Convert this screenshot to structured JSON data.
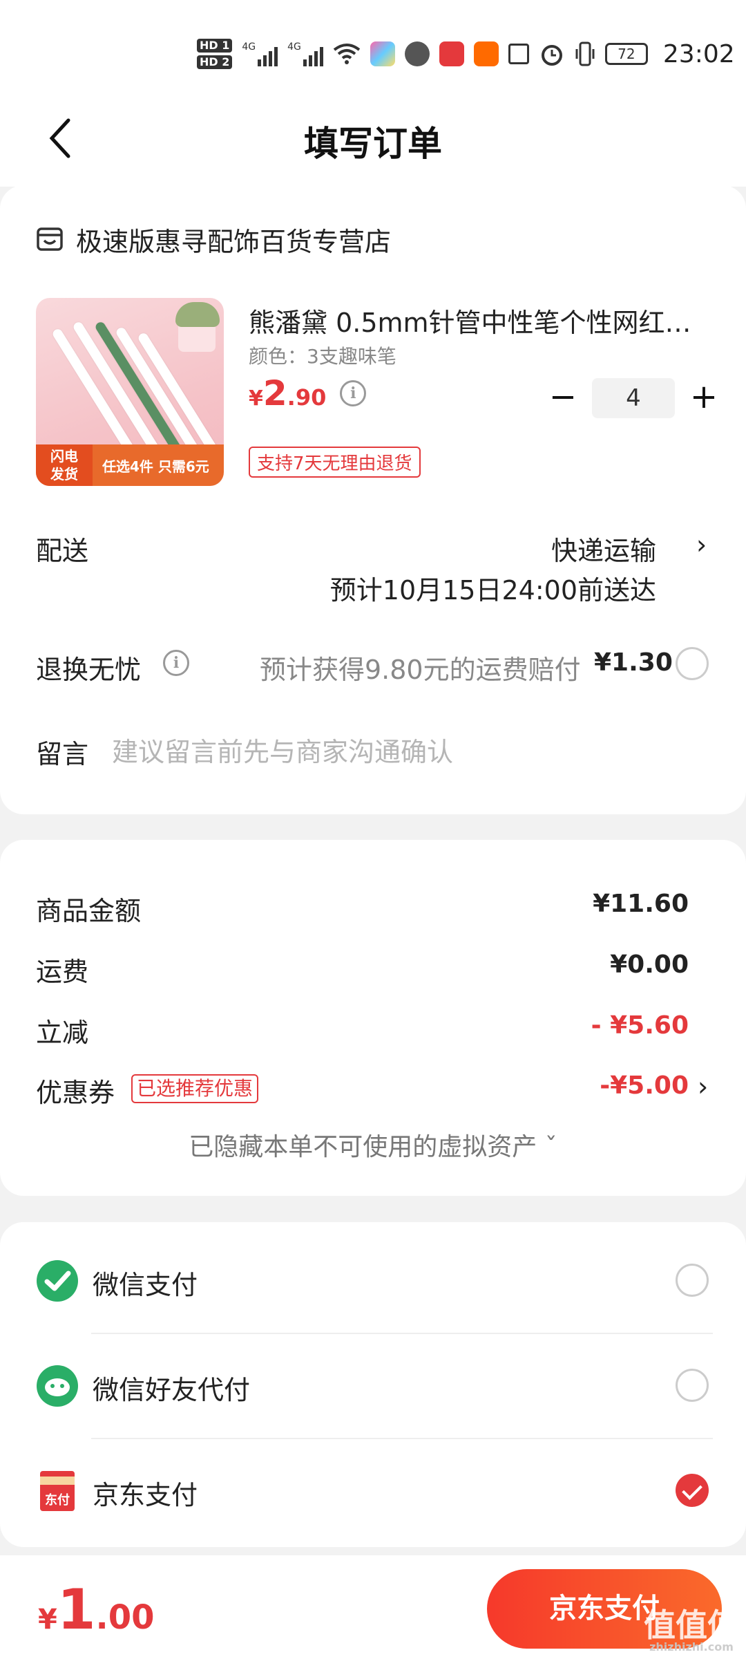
{
  "status_bar": {
    "hd1": "HD 1",
    "hd2": "HD 2",
    "net1": "4G",
    "net2": "4G",
    "battery": "72",
    "time": "23:02"
  },
  "header": {
    "title": "填写订单"
  },
  "store": {
    "name": "极速版惠寻配饰百货专营店"
  },
  "product": {
    "title": "熊潘黛 0.5mm针管中性笔个性网红…",
    "spec": "颜色：3支趣味笔",
    "price_currency": "¥",
    "price_int": "2",
    "price_dec": ".90",
    "quantity": "4",
    "return_tag": "支持7天无理由退货",
    "image_flash": "闪电\n发货",
    "image_promo": "任选4件 只需6元"
  },
  "shipping": {
    "label": "配送",
    "method": "快递运输",
    "eta": "预计10月15日24:00前送达"
  },
  "worry_free": {
    "label": "退换无忧",
    "description": "预计获得9.80元的运费赔付",
    "price": "¥1.30"
  },
  "message": {
    "label": "留言",
    "placeholder": "建议留言前先与商家沟通确认"
  },
  "summary": {
    "goods_label": "商品金额",
    "goods_value": "¥11.60",
    "freight_label": "运费",
    "freight_value": "¥0.00",
    "discount_label": "立减",
    "discount_value": "- ¥5.60",
    "coupon_label": "优惠券",
    "coupon_tag": "已选推荐优惠",
    "coupon_value": "-¥5.00",
    "hidden_assets": "已隐藏本单不可使用的虚拟资产 ˇ"
  },
  "payment": {
    "options": [
      {
        "label": "微信支付",
        "icon": "wechat-pay-icon",
        "selected": false
      },
      {
        "label": "微信好友代付",
        "icon": "wechat-friend-pay-icon",
        "selected": false
      },
      {
        "label": "京东支付",
        "icon": "jd-pay-icon",
        "selected": true
      }
    ]
  },
  "footer": {
    "total_currency": "¥",
    "total_int": "1",
    "total_dec": ".00",
    "pay_button": "京东支付",
    "watermark": "值值值",
    "watermark_sub": "zhizhizhi.com"
  },
  "colors": {
    "accent": "#e4393c",
    "wechat": "#2aae67",
    "jd": "#e4393c"
  }
}
